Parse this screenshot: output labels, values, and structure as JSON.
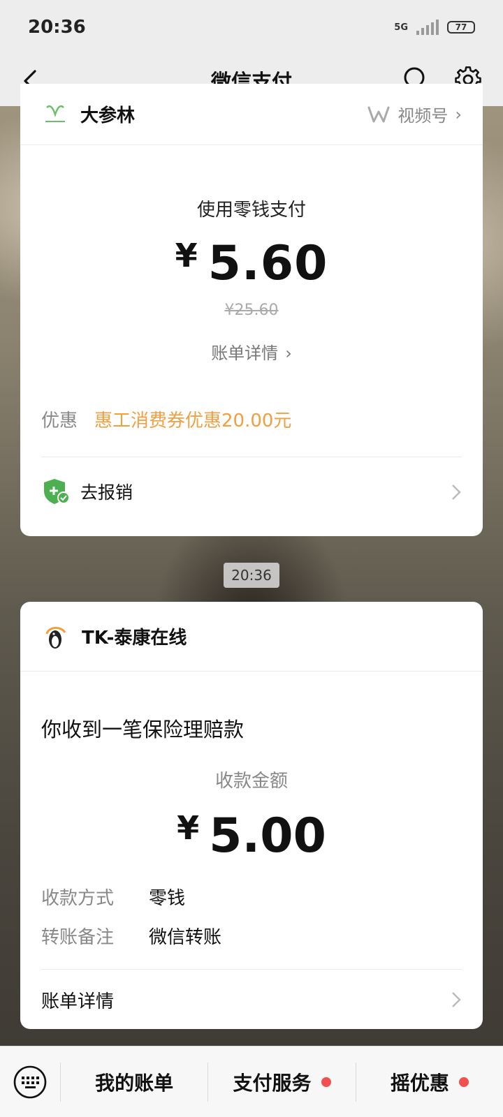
{
  "status_bar": {
    "time": "20:36",
    "network": "5G",
    "battery": "77"
  },
  "nav": {
    "title": "微信支付"
  },
  "card1": {
    "merchant": "大参林",
    "channel": "视频号",
    "pay_method": "使用零钱支付",
    "currency": "¥",
    "amount": "5.60",
    "original_amount": "¥25.60",
    "bill_detail": "账单详情",
    "discount_label": "优惠",
    "discount_value": "惠工消费券优惠20.00元",
    "reimburse_label": "去报销"
  },
  "timestamp": "20:36",
  "card2": {
    "merchant": "TK-泰康在线",
    "notice_title": "你收到一笔保险理赔款",
    "receive_label": "收款金额",
    "currency": "¥",
    "amount": "5.00",
    "rows": [
      {
        "label": "收款方式",
        "value": "零钱"
      },
      {
        "label": "转账备注",
        "value": "微信转账"
      }
    ],
    "footer_label": "账单详情"
  },
  "bottom_bar": {
    "items": [
      {
        "label": "我的账单"
      },
      {
        "label": "支付服务"
      },
      {
        "label": "摇优惠"
      }
    ]
  },
  "colors": {
    "discount": "#f0a040",
    "badge_dot": "#f25050",
    "shield": "#4caf50"
  }
}
